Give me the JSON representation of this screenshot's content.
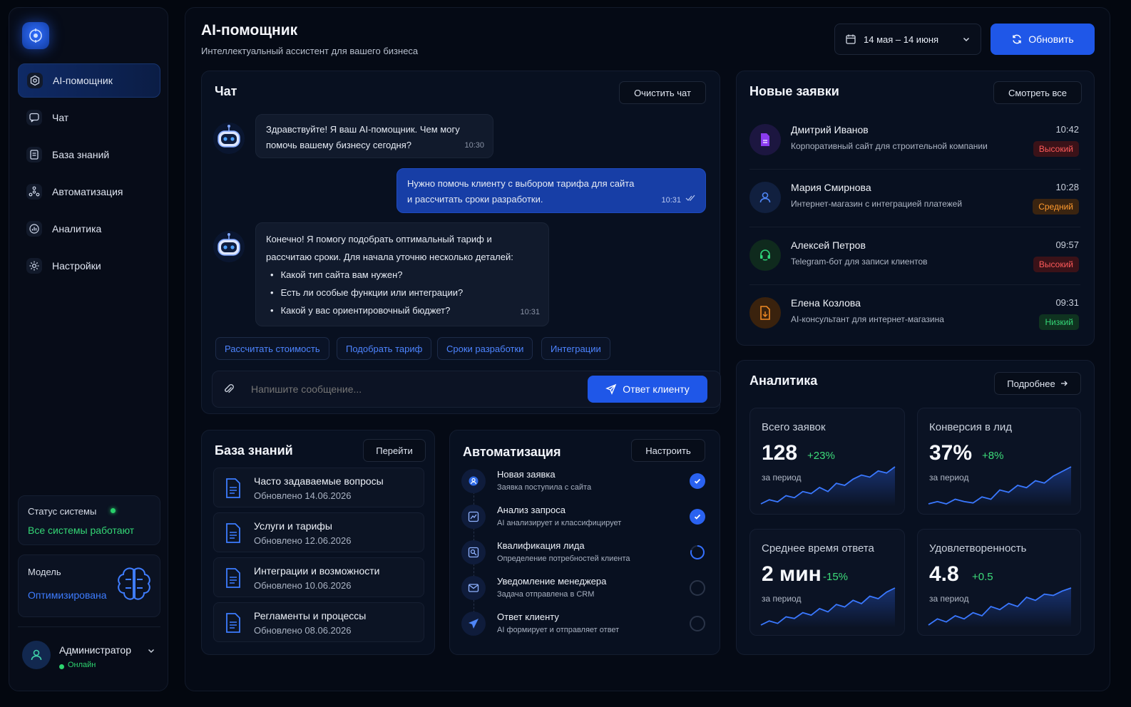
{
  "sidebar": {
    "items": [
      {
        "label": "AI-помощник",
        "icon": "bot-icon"
      },
      {
        "label": "Чат",
        "icon": "chat-icon"
      },
      {
        "label": "База знаний",
        "icon": "book-icon"
      },
      {
        "label": "Автоматизация",
        "icon": "nodes-icon"
      },
      {
        "label": "Аналитика",
        "icon": "chart-icon"
      },
      {
        "label": "Настройки",
        "icon": "gear-icon"
      }
    ],
    "status_label": "Статус системы",
    "status_value": "Все системы работают",
    "model_label": "Модель",
    "model_value": "Оптимизирована",
    "user_name": "Администратор",
    "user_status": "Онлайн"
  },
  "header": {
    "title": "AI-помощник",
    "subtitle": "Интеллектуальный ассистент для вашего бизнеса",
    "date_range": "14 мая – 14 июня",
    "refresh_label": "Обновить"
  },
  "chat": {
    "title": "Чат",
    "clear_label": "Очистить чат",
    "messages": [
      {
        "text_1": "Здравствуйте! Я ваш AI-помощник. Чем могу",
        "text_2": "помочь вашему бизнесу сегодня?",
        "time": "10:30"
      },
      {
        "text_1": "Нужно помочь клиенту с выбором тарифа для сайта",
        "text_2": "и рассчитать сроки разработки.",
        "time": "10:31"
      },
      {
        "text_1": "Конечно! Я помогу подобрать оптимальный тариф и",
        "text_2": "рассчитаю сроки. Для начала уточню несколько деталей:",
        "bullets": [
          "Какой тип сайта вам нужен?",
          "Есть ли особые функции или интеграции?",
          "Какой у вас ориентировочный бюджет?"
        ],
        "time": "10:31"
      }
    ],
    "chips": [
      "Рассчитать стоимость",
      "Подобрать тариф",
      "Сроки разработки",
      "Интеграции"
    ],
    "input_placeholder": "Напишите сообщение...",
    "send_label": "Ответ клиенту"
  },
  "leads": {
    "title": "Новые заявки",
    "view_all": "Смотреть все",
    "items": [
      {
        "name": "Дмитрий Иванов",
        "desc": "Корпоративный сайт для строительной компании",
        "time": "10:42",
        "priority": "Высокий",
        "color": "#8b3cf0"
      },
      {
        "name": "Мария Смирнова",
        "desc": "Интернет-магазин с интеграцией платежей",
        "time": "10:28",
        "priority": "Средний",
        "color": "#3b6fe0"
      },
      {
        "name": "Алексей Петров",
        "desc": "Telegram-бот для записи клиентов",
        "time": "09:57",
        "priority": "Высокий",
        "color": "#22c55e"
      },
      {
        "name": "Елена Козлова",
        "desc": "AI-консультант для интернет-магазина",
        "time": "09:31",
        "priority": "Низкий",
        "color": "#f08a24"
      }
    ]
  },
  "analytics": {
    "title": "Аналитика",
    "more": "Подробнее",
    "period": "за период",
    "stats": [
      {
        "label": "Всего заявок",
        "value": "128",
        "change": "+23%",
        "trend": [
          2,
          3,
          2.5,
          4,
          3.5,
          5,
          4.5,
          6,
          5,
          7,
          6.5,
          8,
          9,
          8.5,
          10,
          9.5,
          11
        ]
      },
      {
        "label": "Конверсия в лид",
        "value": "37%",
        "change": "+8%",
        "trend": [
          2,
          2.5,
          2,
          3,
          2.5,
          2.2,
          3.5,
          3,
          5,
          4.5,
          6,
          5.5,
          7,
          6.5,
          8,
          9,
          10
        ]
      },
      {
        "label": "Среднее время ответа",
        "value": "2 мин",
        "change": "-15%",
        "trend": [
          2,
          2.5,
          2.2,
          3,
          2.8,
          3.5,
          3.2,
          4,
          3.6,
          4.5,
          4.2,
          5,
          4.6,
          5.5,
          5.2,
          6,
          6.5
        ]
      },
      {
        "label": "Удовлетворенность",
        "value": "4.8",
        "change": "+0.5",
        "trend": [
          2,
          3,
          2.5,
          3.5,
          3,
          4,
          3.5,
          5,
          4.5,
          5.5,
          5,
          6.5,
          6,
          7,
          6.8,
          7.5,
          8
        ]
      }
    ]
  },
  "knowledge": {
    "title": "База знаний",
    "go": "Перейти",
    "items": [
      {
        "title": "Часто задаваемые вопросы",
        "date": "Обновлено 14.06.2026"
      },
      {
        "title": "Услуги и тарифы",
        "date": "Обновлено 12.06.2026"
      },
      {
        "title": "Интеграции и возможности",
        "date": "Обновлено 10.06.2026"
      },
      {
        "title": "Регламенты и процессы",
        "date": "Обновлено 08.06.2026"
      }
    ]
  },
  "automation": {
    "title": "Автоматизация",
    "configure": "Настроить",
    "steps": [
      {
        "title": "Новая заявка",
        "desc": "Заявка поступила с сайта",
        "state": "done"
      },
      {
        "title": "Анализ запроса",
        "desc": "AI анализирует и классифицирует",
        "state": "done"
      },
      {
        "title": "Квалификация лида",
        "desc": "Определение потребностей клиента",
        "state": "progress"
      },
      {
        "title": "Уведомление менеджера",
        "desc": "Задача отправлена в CRM",
        "state": "pending"
      },
      {
        "title": "Ответ клиенту",
        "desc": "AI формирует и отправляет ответ",
        "state": "pending"
      }
    ]
  }
}
